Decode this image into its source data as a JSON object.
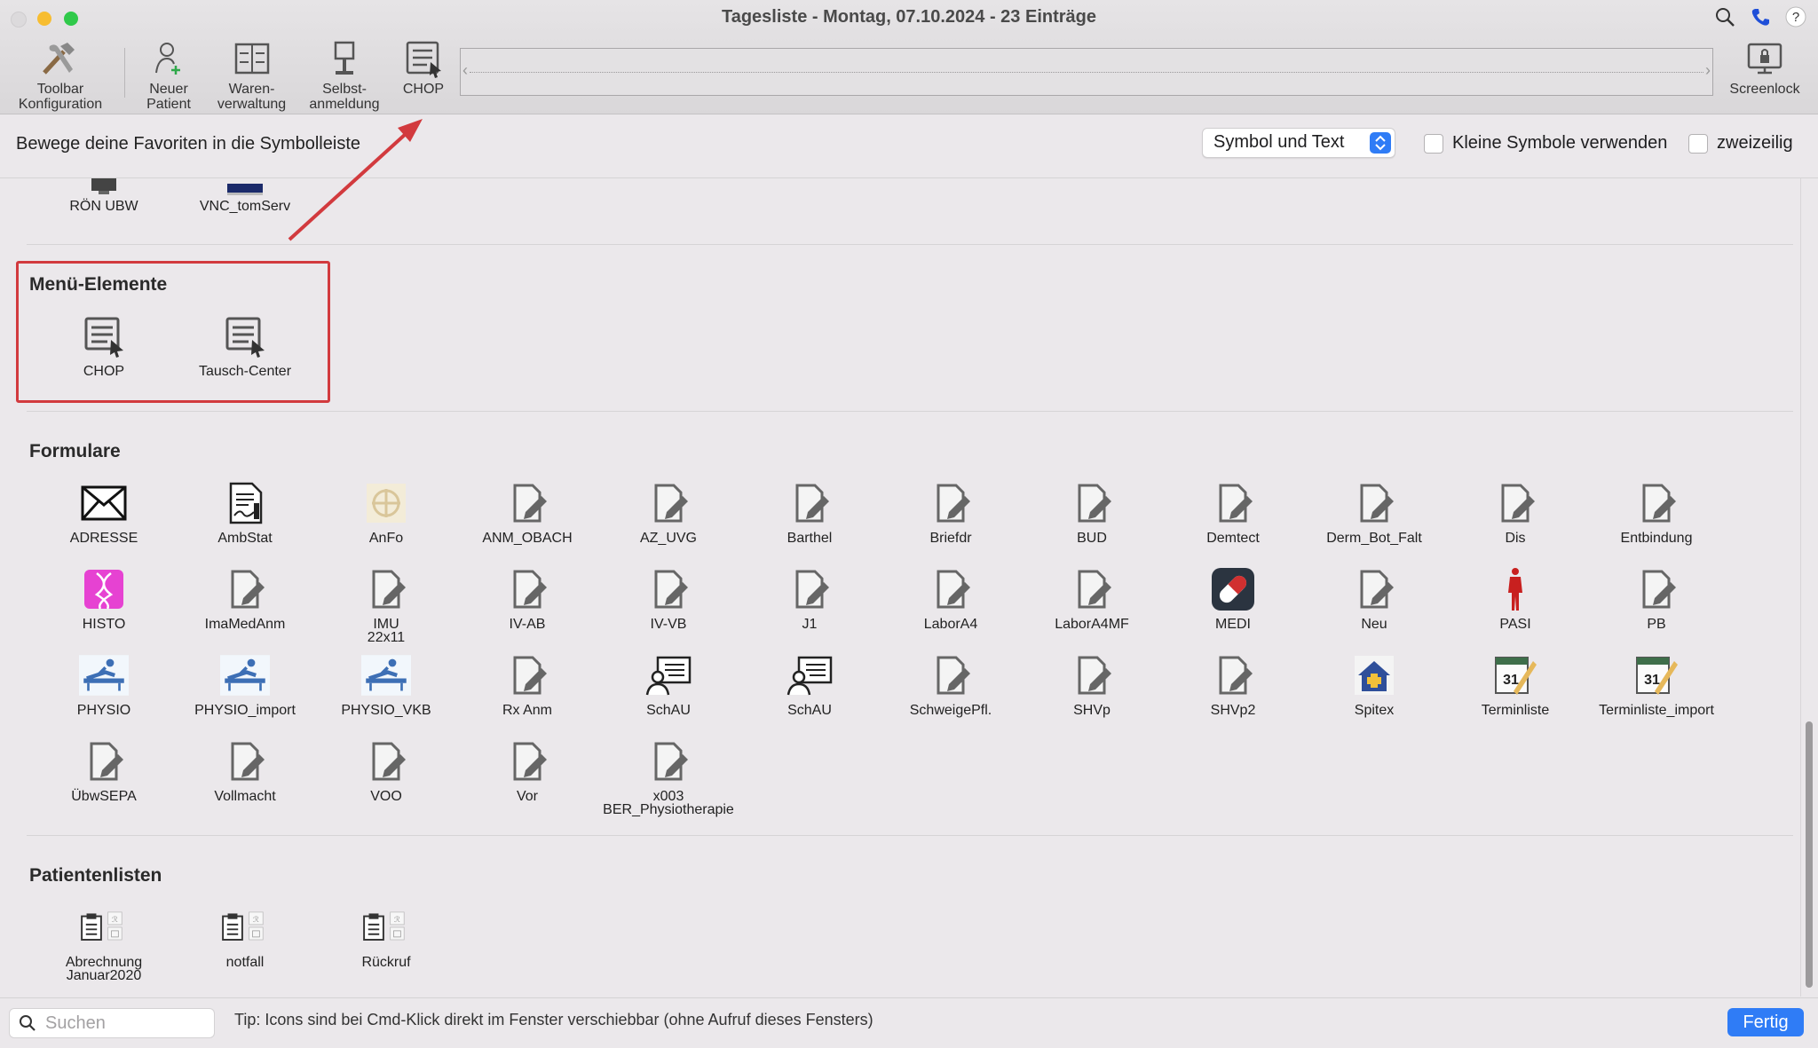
{
  "window": {
    "title": "Tagesliste - Montag, 07.10.2024 - 23 Einträge"
  },
  "toolbar": {
    "items": [
      {
        "label": "Toolbar\nKonfiguration",
        "icon": "tools-icon"
      },
      {
        "label": "Neuer\nPatient",
        "icon": "new-patient-icon"
      },
      {
        "label": "Waren-\nverwaltung",
        "icon": "goods-icon"
      },
      {
        "label": "Selbst-\nanmeldung",
        "icon": "self-checkin-icon"
      },
      {
        "label": "CHOP",
        "icon": "menu-element-icon"
      },
      {
        "label": "Screenlock",
        "icon": "screenlock-icon"
      }
    ]
  },
  "options": {
    "hint": "Bewege deine Favoriten in die Symbolleiste",
    "display_mode": "Symbol und Text",
    "small_icons_label": "Kleine Symbole verwenden",
    "small_icons_checked": false,
    "two_rows_label": "zweizeilig",
    "two_rows_checked": false
  },
  "partial_row": [
    "RÖN UBW",
    "VNC_tomServ"
  ],
  "sections": {
    "menu": {
      "title": "Menü-Elemente",
      "items": [
        "CHOP",
        "Tausch-Center"
      ]
    },
    "forms": {
      "title": "Formulare",
      "items": [
        "ADRESSE",
        "AmbStat",
        "AnFo",
        "ANM_OBACH",
        "AZ_UVG",
        "Barthel",
        "Briefdr",
        "BUD",
        "Demtect",
        "Derm_Bot_Falt",
        "Dis",
        "Entbindung",
        "HISTO",
        "ImaMedAnm",
        "IMU\n22x11",
        "IV-AB",
        "IV-VB",
        "J1",
        "LaborA4",
        "LaborA4MF",
        "MEDI",
        "Neu",
        "PASI",
        "PB",
        "PHYSIO",
        "PHYSIO_import",
        "PHYSIO_VKB",
        "Rx Anm",
        "SchAU",
        "SchAU",
        "SchweigePfl.",
        "SHVp",
        "SHVp2",
        "Spitex",
        "Terminliste",
        "Terminliste_import",
        "ÜbwSEPA",
        "Vollmacht",
        "VOO",
        "Vor",
        "x003\nBER_Physiotherapie"
      ]
    },
    "patient_lists": {
      "title": "Patientenlisten",
      "items": [
        "Abrechnung\nJanuar2020",
        "notfall",
        "Rückruf"
      ]
    }
  },
  "bottom": {
    "search_placeholder": "Suchen",
    "tip": "Tip: Icons sind bei Cmd-Klick direkt im Fenster verschiebbar (ohne Aufruf dieses Fensters)",
    "done_label": "Fertig"
  },
  "colors": {
    "accent": "#2f7cf6",
    "highlight": "#d23a3e"
  }
}
